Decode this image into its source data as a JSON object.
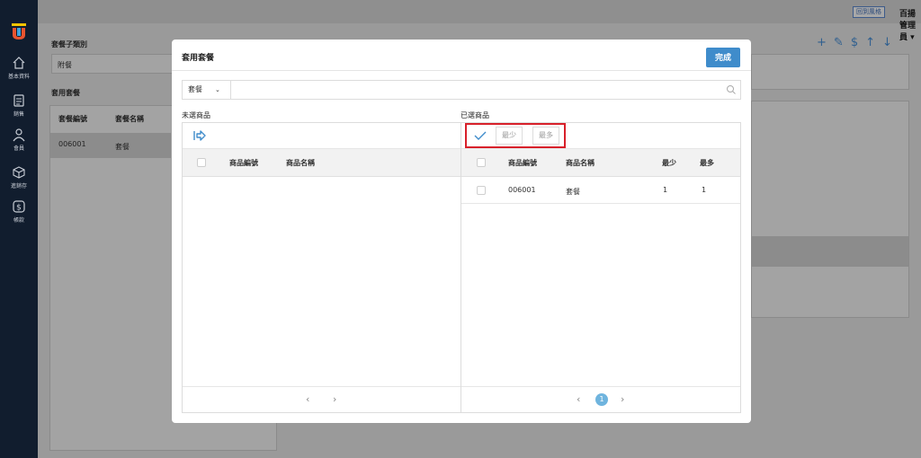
{
  "topbar": {
    "back_label": "回到風格",
    "admin_label": "百揚管理員 ▾"
  },
  "sidebar": {
    "items": [
      {
        "label": "基本資料",
        "icon": "home-icon"
      },
      {
        "label": "銷售",
        "icon": "document-icon"
      },
      {
        "label": "會員",
        "icon": "members-icon"
      },
      {
        "label": "進銷存",
        "icon": "box-icon"
      },
      {
        "label": "帳款",
        "icon": "dollar-icon"
      }
    ]
  },
  "background": {
    "sub_category_label": "套餐子類別",
    "sub_category_value": "附餐",
    "set_meal_label": "套用套餐",
    "col_code": "套餐編號",
    "col_name": "套餐名稱",
    "row_code": "006001",
    "row_name": "套餐"
  },
  "modal": {
    "title": "套用套餐",
    "done_label": "完成",
    "search": {
      "select_value": "套餐",
      "placeholder": ""
    },
    "left_panel": {
      "label": "未選商品",
      "headers": [
        "商品編號",
        "商品名稱"
      ],
      "rows": [],
      "pagination": {
        "prev": "‹",
        "next": "›"
      }
    },
    "right_panel": {
      "label": "已選商品",
      "min_button": "最少",
      "max_button": "最多",
      "headers": [
        "商品編號",
        "商品名稱",
        "最少",
        "最多"
      ],
      "rows": [
        {
          "code": "006001",
          "name": "套餐",
          "min": "1",
          "max": "1"
        }
      ],
      "pagination": {
        "prev": "‹",
        "page": "1",
        "next": "›"
      }
    }
  },
  "colors": {
    "accent": "#3f8ccb",
    "sidebar_bg": "#111d2e",
    "highlight": "#d8202a"
  }
}
